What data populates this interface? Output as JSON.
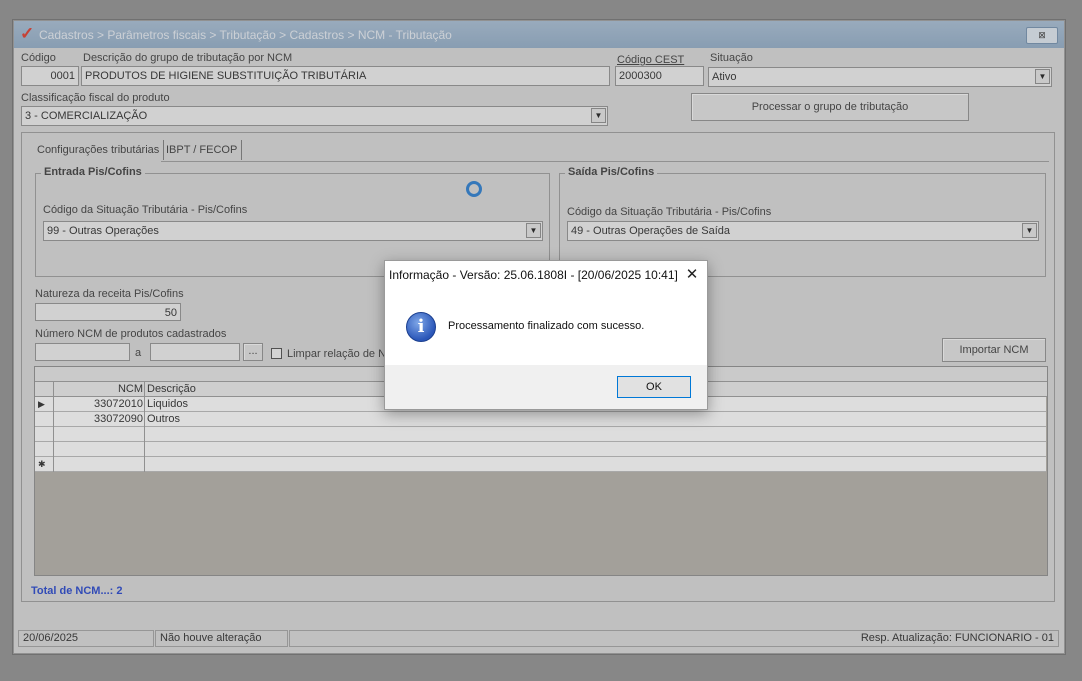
{
  "window": {
    "title": "Cadastros > Parâmetros fiscais > Tributação > Cadastros > NCM - Tributação",
    "close_glyph": "⊠"
  },
  "form": {
    "codigo": {
      "label": "Código",
      "value": "0001"
    },
    "descricao": {
      "label": "Descrição do grupo de tributação por NCM",
      "value": "PRODUTOS DE HIGIENE SUBSTITUIÇÃO TRIBUTÁRIA"
    },
    "cest": {
      "label": "Código CEST",
      "value": "2000300"
    },
    "situacao": {
      "label": "Situação",
      "value": "Ativo"
    },
    "classificacao": {
      "label": "Classificação fiscal do produto",
      "value": "3 - COMERCIALIZAÇÃO"
    },
    "processar_button": "Processar o grupo de tributação"
  },
  "tabs": [
    {
      "label": "Configurações tributárias"
    },
    {
      "label": "IBPT / FECOP"
    }
  ],
  "entrada": {
    "title": "Entrada Pis/Cofins",
    "cst_label": "Código da Situação Tributária - Pis/Cofins",
    "cst_value": "99 -  Outras Operações"
  },
  "saida": {
    "title": "Saída Pis/Cofins",
    "cst_label": "Código da Situação Tributária - Pis/Cofins",
    "cst_value": "49 -  Outras Operações de Saída"
  },
  "natureza": {
    "label": "Natureza da receita Pis/Cofins",
    "value": "50"
  },
  "ncm_range": {
    "label": "Número  NCM de produtos cadastrados",
    "from": "",
    "separator": "a",
    "to": "",
    "browse": "...",
    "limpar_label": "Limpar relação de NI"
  },
  "importar_button": "Importar NCM",
  "grid": {
    "headers": {
      "ncm": "NCM",
      "descricao": "Descrição"
    },
    "rows": [
      {
        "indicator": "▶",
        "ncm": "33072010",
        "descricao": "Liquidos"
      },
      {
        "indicator": "",
        "ncm": "33072090",
        "descricao": "Outros"
      },
      {
        "indicator": "",
        "ncm": "",
        "descricao": ""
      },
      {
        "indicator": "",
        "ncm": "",
        "descricao": ""
      },
      {
        "indicator": "✱",
        "ncm": "",
        "descricao": ""
      }
    ]
  },
  "total": {
    "text": "Total de NCM...: 2",
    "color": "#1a3ccc"
  },
  "statusbar": {
    "date": "20/06/2025",
    "change": "Não houve alteração",
    "resp": "Resp. Atualização: FUNCIONARIO - 01"
  },
  "dialog": {
    "title": "Informação - Versão: 25.06.1808I - [20/06/2025 10:41]",
    "close_glyph": "✕",
    "icon": "information-icon",
    "icon_glyph": "i",
    "message": "Processamento finalizado com sucesso.",
    "ok": "OK"
  },
  "colors": {
    "accent": "#0078d7",
    "titlebar": "#9bb4cd",
    "logo": "#e03020"
  }
}
